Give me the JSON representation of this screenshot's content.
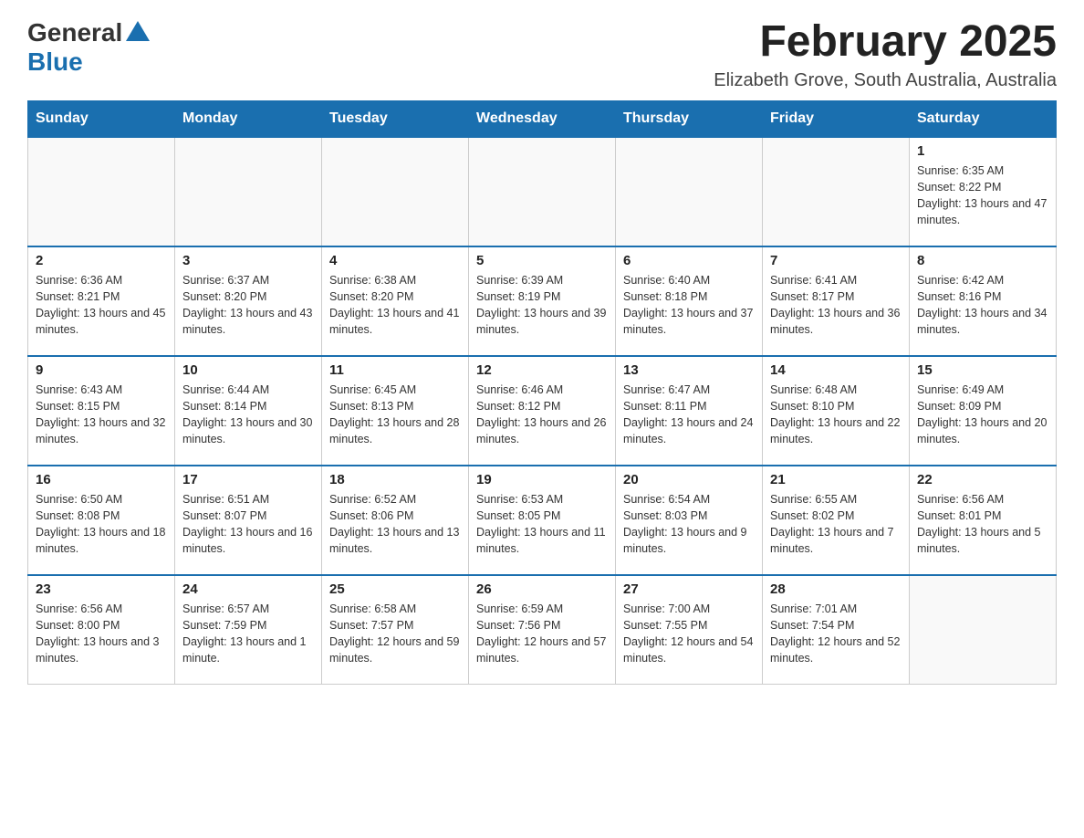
{
  "header": {
    "logo_general": "General",
    "logo_blue": "Blue",
    "month_year": "February 2025",
    "location": "Elizabeth Grove, South Australia, Australia"
  },
  "days_of_week": [
    "Sunday",
    "Monday",
    "Tuesday",
    "Wednesday",
    "Thursday",
    "Friday",
    "Saturday"
  ],
  "weeks": [
    [
      {
        "day": "",
        "info": ""
      },
      {
        "day": "",
        "info": ""
      },
      {
        "day": "",
        "info": ""
      },
      {
        "day": "",
        "info": ""
      },
      {
        "day": "",
        "info": ""
      },
      {
        "day": "",
        "info": ""
      },
      {
        "day": "1",
        "info": "Sunrise: 6:35 AM\nSunset: 8:22 PM\nDaylight: 13 hours and 47 minutes."
      }
    ],
    [
      {
        "day": "2",
        "info": "Sunrise: 6:36 AM\nSunset: 8:21 PM\nDaylight: 13 hours and 45 minutes."
      },
      {
        "day": "3",
        "info": "Sunrise: 6:37 AM\nSunset: 8:20 PM\nDaylight: 13 hours and 43 minutes."
      },
      {
        "day": "4",
        "info": "Sunrise: 6:38 AM\nSunset: 8:20 PM\nDaylight: 13 hours and 41 minutes."
      },
      {
        "day": "5",
        "info": "Sunrise: 6:39 AM\nSunset: 8:19 PM\nDaylight: 13 hours and 39 minutes."
      },
      {
        "day": "6",
        "info": "Sunrise: 6:40 AM\nSunset: 8:18 PM\nDaylight: 13 hours and 37 minutes."
      },
      {
        "day": "7",
        "info": "Sunrise: 6:41 AM\nSunset: 8:17 PM\nDaylight: 13 hours and 36 minutes."
      },
      {
        "day": "8",
        "info": "Sunrise: 6:42 AM\nSunset: 8:16 PM\nDaylight: 13 hours and 34 minutes."
      }
    ],
    [
      {
        "day": "9",
        "info": "Sunrise: 6:43 AM\nSunset: 8:15 PM\nDaylight: 13 hours and 32 minutes."
      },
      {
        "day": "10",
        "info": "Sunrise: 6:44 AM\nSunset: 8:14 PM\nDaylight: 13 hours and 30 minutes."
      },
      {
        "day": "11",
        "info": "Sunrise: 6:45 AM\nSunset: 8:13 PM\nDaylight: 13 hours and 28 minutes."
      },
      {
        "day": "12",
        "info": "Sunrise: 6:46 AM\nSunset: 8:12 PM\nDaylight: 13 hours and 26 minutes."
      },
      {
        "day": "13",
        "info": "Sunrise: 6:47 AM\nSunset: 8:11 PM\nDaylight: 13 hours and 24 minutes."
      },
      {
        "day": "14",
        "info": "Sunrise: 6:48 AM\nSunset: 8:10 PM\nDaylight: 13 hours and 22 minutes."
      },
      {
        "day": "15",
        "info": "Sunrise: 6:49 AM\nSunset: 8:09 PM\nDaylight: 13 hours and 20 minutes."
      }
    ],
    [
      {
        "day": "16",
        "info": "Sunrise: 6:50 AM\nSunset: 8:08 PM\nDaylight: 13 hours and 18 minutes."
      },
      {
        "day": "17",
        "info": "Sunrise: 6:51 AM\nSunset: 8:07 PM\nDaylight: 13 hours and 16 minutes."
      },
      {
        "day": "18",
        "info": "Sunrise: 6:52 AM\nSunset: 8:06 PM\nDaylight: 13 hours and 13 minutes."
      },
      {
        "day": "19",
        "info": "Sunrise: 6:53 AM\nSunset: 8:05 PM\nDaylight: 13 hours and 11 minutes."
      },
      {
        "day": "20",
        "info": "Sunrise: 6:54 AM\nSunset: 8:03 PM\nDaylight: 13 hours and 9 minutes."
      },
      {
        "day": "21",
        "info": "Sunrise: 6:55 AM\nSunset: 8:02 PM\nDaylight: 13 hours and 7 minutes."
      },
      {
        "day": "22",
        "info": "Sunrise: 6:56 AM\nSunset: 8:01 PM\nDaylight: 13 hours and 5 minutes."
      }
    ],
    [
      {
        "day": "23",
        "info": "Sunrise: 6:56 AM\nSunset: 8:00 PM\nDaylight: 13 hours and 3 minutes."
      },
      {
        "day": "24",
        "info": "Sunrise: 6:57 AM\nSunset: 7:59 PM\nDaylight: 13 hours and 1 minute."
      },
      {
        "day": "25",
        "info": "Sunrise: 6:58 AM\nSunset: 7:57 PM\nDaylight: 12 hours and 59 minutes."
      },
      {
        "day": "26",
        "info": "Sunrise: 6:59 AM\nSunset: 7:56 PM\nDaylight: 12 hours and 57 minutes."
      },
      {
        "day": "27",
        "info": "Sunrise: 7:00 AM\nSunset: 7:55 PM\nDaylight: 12 hours and 54 minutes."
      },
      {
        "day": "28",
        "info": "Sunrise: 7:01 AM\nSunset: 7:54 PM\nDaylight: 12 hours and 52 minutes."
      },
      {
        "day": "",
        "info": ""
      }
    ]
  ]
}
